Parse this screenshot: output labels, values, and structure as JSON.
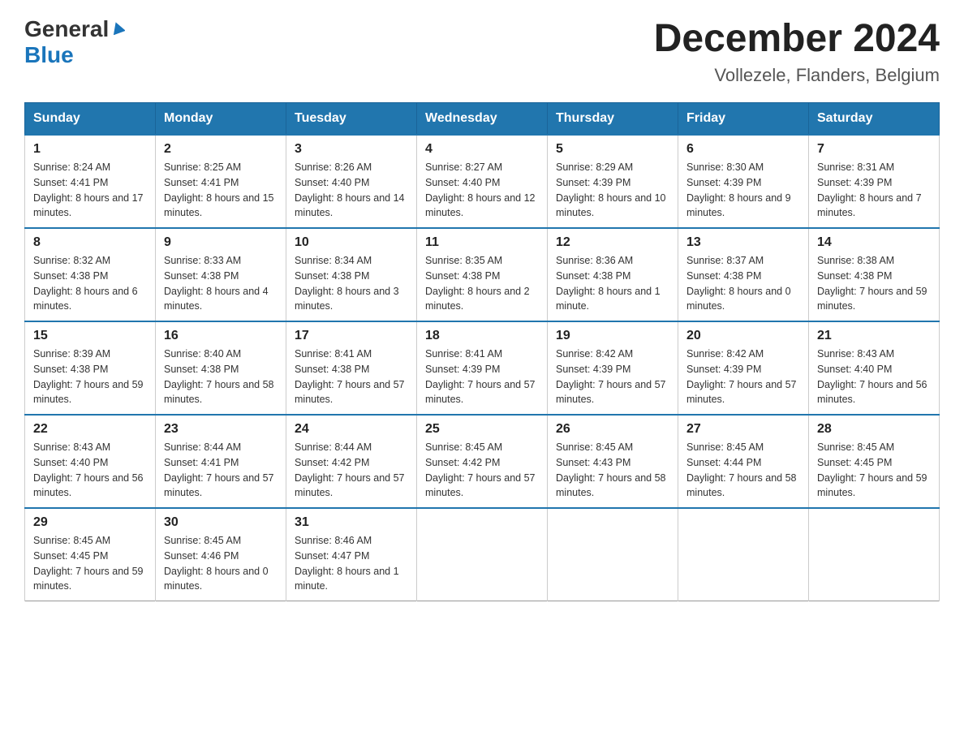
{
  "header": {
    "logo_general": "General",
    "logo_blue": "Blue",
    "month_title": "December 2024",
    "location": "Vollezele, Flanders, Belgium"
  },
  "weekdays": [
    "Sunday",
    "Monday",
    "Tuesday",
    "Wednesday",
    "Thursday",
    "Friday",
    "Saturday"
  ],
  "weeks": [
    [
      {
        "day": "1",
        "sunrise": "8:24 AM",
        "sunset": "4:41 PM",
        "daylight": "8 hours and 17 minutes."
      },
      {
        "day": "2",
        "sunrise": "8:25 AM",
        "sunset": "4:41 PM",
        "daylight": "8 hours and 15 minutes."
      },
      {
        "day": "3",
        "sunrise": "8:26 AM",
        "sunset": "4:40 PM",
        "daylight": "8 hours and 14 minutes."
      },
      {
        "day": "4",
        "sunrise": "8:27 AM",
        "sunset": "4:40 PM",
        "daylight": "8 hours and 12 minutes."
      },
      {
        "day": "5",
        "sunrise": "8:29 AM",
        "sunset": "4:39 PM",
        "daylight": "8 hours and 10 minutes."
      },
      {
        "day": "6",
        "sunrise": "8:30 AM",
        "sunset": "4:39 PM",
        "daylight": "8 hours and 9 minutes."
      },
      {
        "day": "7",
        "sunrise": "8:31 AM",
        "sunset": "4:39 PM",
        "daylight": "8 hours and 7 minutes."
      }
    ],
    [
      {
        "day": "8",
        "sunrise": "8:32 AM",
        "sunset": "4:38 PM",
        "daylight": "8 hours and 6 minutes."
      },
      {
        "day": "9",
        "sunrise": "8:33 AM",
        "sunset": "4:38 PM",
        "daylight": "8 hours and 4 minutes."
      },
      {
        "day": "10",
        "sunrise": "8:34 AM",
        "sunset": "4:38 PM",
        "daylight": "8 hours and 3 minutes."
      },
      {
        "day": "11",
        "sunrise": "8:35 AM",
        "sunset": "4:38 PM",
        "daylight": "8 hours and 2 minutes."
      },
      {
        "day": "12",
        "sunrise": "8:36 AM",
        "sunset": "4:38 PM",
        "daylight": "8 hours and 1 minute."
      },
      {
        "day": "13",
        "sunrise": "8:37 AM",
        "sunset": "4:38 PM",
        "daylight": "8 hours and 0 minutes."
      },
      {
        "day": "14",
        "sunrise": "8:38 AM",
        "sunset": "4:38 PM",
        "daylight": "7 hours and 59 minutes."
      }
    ],
    [
      {
        "day": "15",
        "sunrise": "8:39 AM",
        "sunset": "4:38 PM",
        "daylight": "7 hours and 59 minutes."
      },
      {
        "day": "16",
        "sunrise": "8:40 AM",
        "sunset": "4:38 PM",
        "daylight": "7 hours and 58 minutes."
      },
      {
        "day": "17",
        "sunrise": "8:41 AM",
        "sunset": "4:38 PM",
        "daylight": "7 hours and 57 minutes."
      },
      {
        "day": "18",
        "sunrise": "8:41 AM",
        "sunset": "4:39 PM",
        "daylight": "7 hours and 57 minutes."
      },
      {
        "day": "19",
        "sunrise": "8:42 AM",
        "sunset": "4:39 PM",
        "daylight": "7 hours and 57 minutes."
      },
      {
        "day": "20",
        "sunrise": "8:42 AM",
        "sunset": "4:39 PM",
        "daylight": "7 hours and 57 minutes."
      },
      {
        "day": "21",
        "sunrise": "8:43 AM",
        "sunset": "4:40 PM",
        "daylight": "7 hours and 56 minutes."
      }
    ],
    [
      {
        "day": "22",
        "sunrise": "8:43 AM",
        "sunset": "4:40 PM",
        "daylight": "7 hours and 56 minutes."
      },
      {
        "day": "23",
        "sunrise": "8:44 AM",
        "sunset": "4:41 PM",
        "daylight": "7 hours and 57 minutes."
      },
      {
        "day": "24",
        "sunrise": "8:44 AM",
        "sunset": "4:42 PM",
        "daylight": "7 hours and 57 minutes."
      },
      {
        "day": "25",
        "sunrise": "8:45 AM",
        "sunset": "4:42 PM",
        "daylight": "7 hours and 57 minutes."
      },
      {
        "day": "26",
        "sunrise": "8:45 AM",
        "sunset": "4:43 PM",
        "daylight": "7 hours and 58 minutes."
      },
      {
        "day": "27",
        "sunrise": "8:45 AM",
        "sunset": "4:44 PM",
        "daylight": "7 hours and 58 minutes."
      },
      {
        "day": "28",
        "sunrise": "8:45 AM",
        "sunset": "4:45 PM",
        "daylight": "7 hours and 59 minutes."
      }
    ],
    [
      {
        "day": "29",
        "sunrise": "8:45 AM",
        "sunset": "4:45 PM",
        "daylight": "7 hours and 59 minutes."
      },
      {
        "day": "30",
        "sunrise": "8:45 AM",
        "sunset": "4:46 PM",
        "daylight": "8 hours and 0 minutes."
      },
      {
        "day": "31",
        "sunrise": "8:46 AM",
        "sunset": "4:47 PM",
        "daylight": "8 hours and 1 minute."
      },
      null,
      null,
      null,
      null
    ]
  ]
}
